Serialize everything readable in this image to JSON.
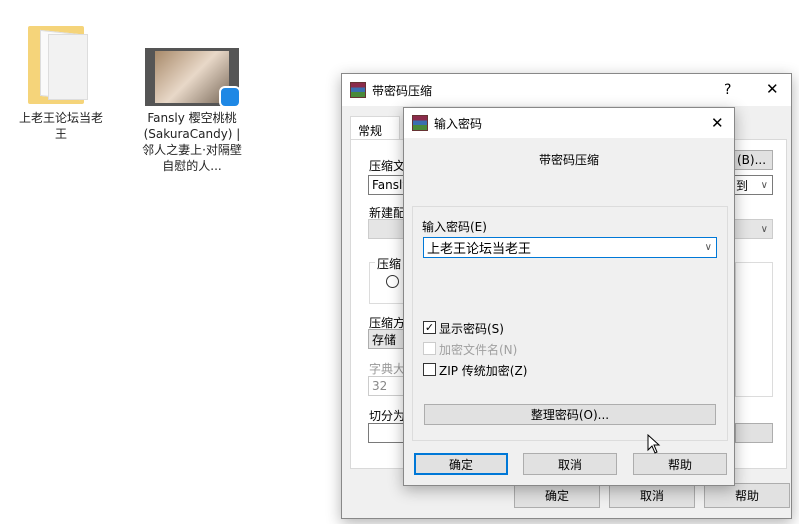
{
  "desktop": {
    "folder_label": "上老王论坛当老王",
    "video_label": "Fansly 樱空桃桃 (SakuraCandy) | 邻人之妻上·对隔壁自慰的人..."
  },
  "bg_dialog": {
    "title": "带密码压缩",
    "help_glyph": "?",
    "close_glyph": "✕",
    "tab_general": "常规",
    "archive_name_label": "压缩文",
    "archive_name_value": "Fansly",
    "browse_button": "(B)...",
    "update_mode_value": "到",
    "profile_label": "新建配",
    "format_group": "压缩",
    "method_label": "压缩方",
    "method_value": "存储",
    "dict_label": "字典大",
    "dict_value": "32",
    "split_label": "切分为",
    "ok": "确定",
    "cancel": "取消",
    "help": "帮助"
  },
  "pw_dialog": {
    "title": "输入密码",
    "close_glyph": "✕",
    "header": "带密码压缩",
    "password_label": "输入密码(E)",
    "password_value": "上老王论坛当老王",
    "show_password": {
      "label": "显示密码(S)",
      "checked": true
    },
    "encrypt_names": {
      "label": "加密文件名(N)",
      "checked": false,
      "disabled": true
    },
    "zip_legacy": {
      "label": "ZIP 传统加密(Z)",
      "checked": false
    },
    "organize_button": "整理密码(O)...",
    "ok": "确定",
    "cancel": "取消",
    "help": "帮助"
  }
}
